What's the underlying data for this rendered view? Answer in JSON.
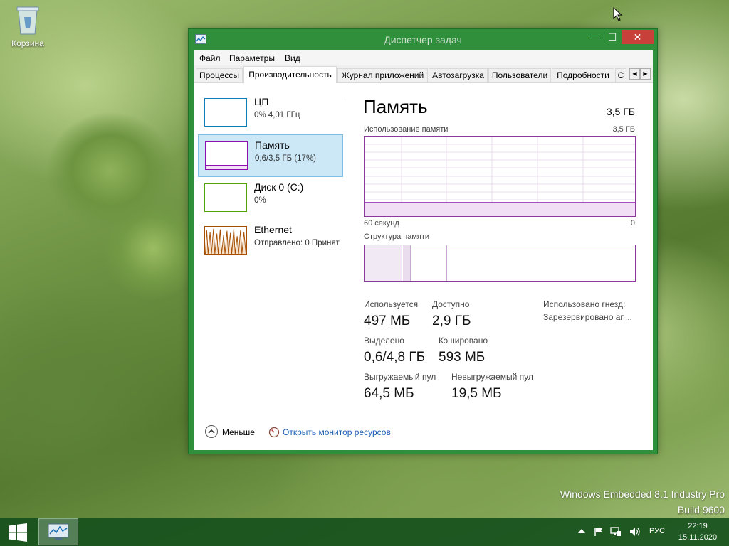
{
  "desktop": {
    "recycle_bin_label": "Корзина",
    "watermark_line1": "Windows Embedded 8.1 Industry Pro",
    "watermark_line2": "Build 9600"
  },
  "window": {
    "title": "Диспетчер задач",
    "accent_color": "#2f8f3a",
    "buttons": {
      "minimize": "—",
      "maximize": "☐",
      "close": "✕"
    }
  },
  "menu": [
    "Файл",
    "Параметры",
    "Вид"
  ],
  "tabs": [
    {
      "label": "Процессы",
      "active": false
    },
    {
      "label": "Производительность",
      "active": true
    },
    {
      "label": "Журнал приложений",
      "active": false
    },
    {
      "label": "Автозагрузка",
      "active": false
    },
    {
      "label": "Пользователи",
      "active": false
    },
    {
      "label": "Подробности",
      "active": false
    },
    {
      "label": "С",
      "active": false
    }
  ],
  "tab_scroll": {
    "left": "◀",
    "right": "▶"
  },
  "resources": [
    {
      "name": "ЦП",
      "sub": "0% 4,01 ГГц",
      "color": "#117dbb",
      "selected": false
    },
    {
      "name": "Память",
      "sub": "0,6/3,5 ГБ (17%)",
      "color": "#8b12ae",
      "selected": true
    },
    {
      "name": "Диск 0 (C:)",
      "sub": "0%",
      "color": "#4da60c",
      "selected": false
    },
    {
      "name": "Ethernet",
      "sub": "Отправлено: 0 Принят",
      "color": "#a74f01",
      "selected": false
    }
  ],
  "memory": {
    "title": "Память",
    "total": "3,5 ГБ",
    "usage_label": "Использование памяти",
    "usage_max": "3,5 ГБ",
    "axis_left": "60 секунд",
    "axis_right": "0",
    "usage_fraction": 0.17,
    "composition_label": "Структура памяти",
    "stats": {
      "in_use_label": "Используется",
      "in_use": "497 МБ",
      "available_label": "Доступно",
      "available": "2,9 ГБ",
      "committed_label": "Выделено",
      "committed": "0,6/4,8 ГБ",
      "cached_label": "Кэшировано",
      "cached": "593 МБ",
      "paged_label": "Выгружаемый пул",
      "paged": "64,5 МБ",
      "nonpaged_label": "Невыгружаемый пул",
      "nonpaged": "19,5 МБ",
      "slots_label": "Использовано гнезд:",
      "reserved_label": "Зарезервировано ап..."
    }
  },
  "footer": {
    "fewer": "Меньше",
    "open_monitor": "Открыть монитор ресурсов"
  },
  "taskbar": {
    "language": "РУС",
    "time": "22:19",
    "date": "15.11.2020"
  }
}
